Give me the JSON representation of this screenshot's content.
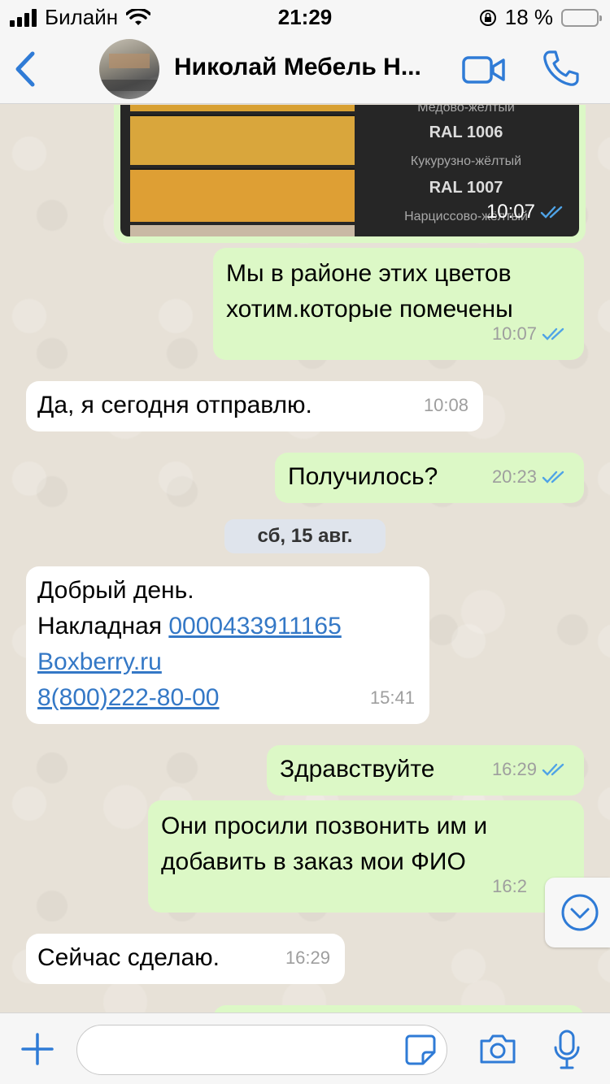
{
  "status_bar": {
    "carrier": "Билайн",
    "time": "21:29",
    "battery": "18 %",
    "battery_level": 0.18,
    "icons": [
      "signal-icon",
      "wifi-icon",
      "orientation-lock-icon",
      "battery-icon"
    ]
  },
  "header": {
    "contact_name": "Николай  Мебель Н...",
    "icons": [
      "back-chevron-icon",
      "video-call-icon",
      "phone-icon"
    ]
  },
  "image_message": {
    "labels": [
      "Медово-жёлтый",
      "RAL 1006",
      "Кукурузно-жёлтый",
      "RAL 1007",
      "Нарциссово-жёлтый"
    ],
    "time": "10:07",
    "swatch_colors": [
      "#d9a63c",
      "#de9f34"
    ]
  },
  "messages": [
    {
      "direction": "out",
      "lines": [
        "Мы в районе этих цветов",
        "хотим.которые помечены"
      ],
      "time": "10:07",
      "read": true
    },
    {
      "direction": "in",
      "lines": [
        "Да, я сегодня отправлю."
      ],
      "time": "10:08"
    },
    {
      "direction": "out",
      "lines": [
        "Получилось?"
      ],
      "time": "20:23",
      "read": true
    },
    {
      "direction": "in",
      "lines": [
        "Добрый день.",
        "Накладная ",
        "0000433911165",
        "Boxberry.ru",
        "8(800)222-80-00"
      ],
      "time": "15:41"
    },
    {
      "direction": "out",
      "lines": [
        "Здравствуйте"
      ],
      "time": "16:29",
      "read": true
    },
    {
      "direction": "out",
      "lines": [
        "Они просили позвонить им и",
        "добавить в заказ мои ФИО"
      ],
      "time": "16:2"
    },
    {
      "direction": "in",
      "lines": [
        "Сейчас сделаю."
      ],
      "time": "16:29"
    }
  ],
  "date_separator": "сб, 15 авг.",
  "composer": {
    "placeholder": "",
    "value": "",
    "icons": [
      "plus-icon",
      "sticker-icon",
      "camera-icon",
      "microphone-icon"
    ]
  },
  "colors": {
    "outgoing_bubble": "#dcf8c6",
    "incoming_bubble": "#ffffff",
    "accent": "#2f7bd6",
    "read_ticks": "#4fa3e6",
    "link": "#3478c6"
  }
}
